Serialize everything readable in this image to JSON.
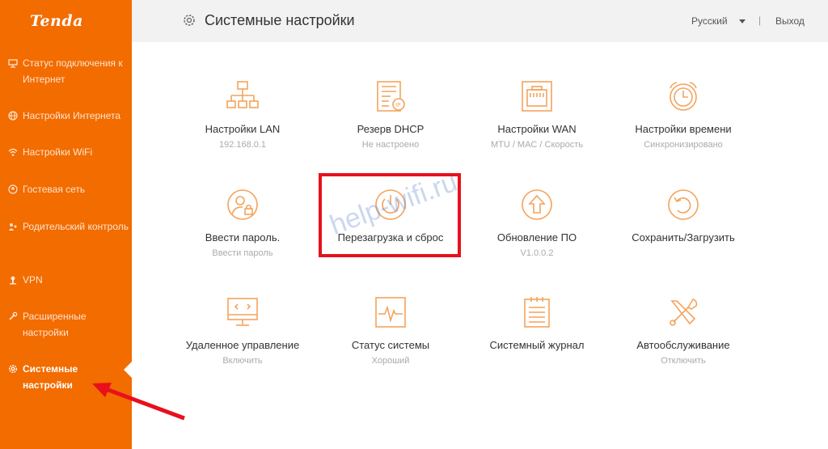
{
  "brand": {
    "logo": "Tenda",
    "accent": "#f26c00",
    "highlight": "#e8101c"
  },
  "sidebar": {
    "items": [
      {
        "label": "Статус подключения к Интернет",
        "icon": "connection-status-icon"
      },
      {
        "label": "Настройки Интернета",
        "icon": "globe-icon"
      },
      {
        "label": "Настройки WiFi",
        "icon": "wifi-icon"
      },
      {
        "label": "Гостевая сеть",
        "icon": "guest-icon"
      },
      {
        "label": "Родительский контроль",
        "icon": "parental-icon"
      },
      {
        "label": "VPN",
        "icon": "vpn-icon"
      },
      {
        "label": "Расширенные настройки",
        "icon": "wrench-icon"
      },
      {
        "label": "Системные настройки",
        "icon": "gear-icon",
        "active": true
      }
    ]
  },
  "header": {
    "title": "Системные настройки",
    "language": "Русский",
    "separator": "|",
    "logout": "Выход"
  },
  "tiles": [
    {
      "label": "Настройки LAN",
      "sub": "192.168.0.1",
      "icon": "lan-topology-icon"
    },
    {
      "label": "Резерв DHCP",
      "sub": "Не настроено",
      "icon": "dhcp-reservation-icon"
    },
    {
      "label": "Настройки WAN",
      "sub": "MTU / MAC / Скорость",
      "icon": "wan-port-icon"
    },
    {
      "label": "Настройки времени",
      "sub": "Синхронизировано",
      "icon": "alarm-clock-icon"
    },
    {
      "label": "Ввести пароль.",
      "sub": "Ввести пароль",
      "icon": "user-lock-icon"
    },
    {
      "label": "Перезагрузка и сброс",
      "sub": "",
      "icon": "power-icon"
    },
    {
      "label": "Обновление ПО",
      "sub": "V1.0.0.2",
      "icon": "upgrade-arrow-icon"
    },
    {
      "label": "Сохранить/Загрузить",
      "sub": "",
      "icon": "backup-restore-icon"
    },
    {
      "label": "Удаленное управление",
      "sub": "Включить",
      "icon": "remote-monitor-icon"
    },
    {
      "label": "Статус системы",
      "sub": "Хороший",
      "icon": "system-pulse-icon"
    },
    {
      "label": "Системный журнал",
      "sub": "",
      "icon": "log-list-icon"
    },
    {
      "label": "Автообслуживание",
      "sub": "Отключить",
      "icon": "tools-icon"
    }
  ],
  "watermark": "help-wifi.ru"
}
